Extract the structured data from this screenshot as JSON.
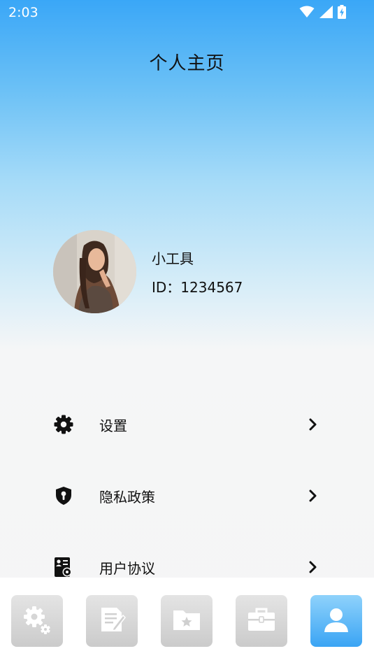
{
  "status_bar": {
    "time": "2:03",
    "icons": [
      "wifi-icon",
      "cell-signal-icon",
      "battery-charging-icon"
    ]
  },
  "header": {
    "title": "个人主页"
  },
  "profile": {
    "avatar_icon": "user-photo",
    "name": "小工具",
    "id_text": "ID：1234567"
  },
  "menu": {
    "items": [
      {
        "label": "设置",
        "icon": "gear-icon"
      },
      {
        "label": "隐私政策",
        "icon": "shield-lock-icon"
      },
      {
        "label": "用户协议",
        "icon": "user-agreement-icon"
      }
    ]
  },
  "bottom_nav": {
    "items": [
      {
        "icon": "settings-gears-icon",
        "active": false
      },
      {
        "icon": "notes-icon",
        "active": false
      },
      {
        "icon": "folder-star-icon",
        "active": false
      },
      {
        "icon": "briefcase-icon",
        "active": false
      },
      {
        "icon": "person-icon",
        "active": true
      }
    ]
  },
  "colors": {
    "gradient_top": "#3aa7f7",
    "gradient_bottom": "#f5f5f5",
    "active_nav": "#3aa4f4",
    "inactive_nav": "#cbcbcb"
  }
}
